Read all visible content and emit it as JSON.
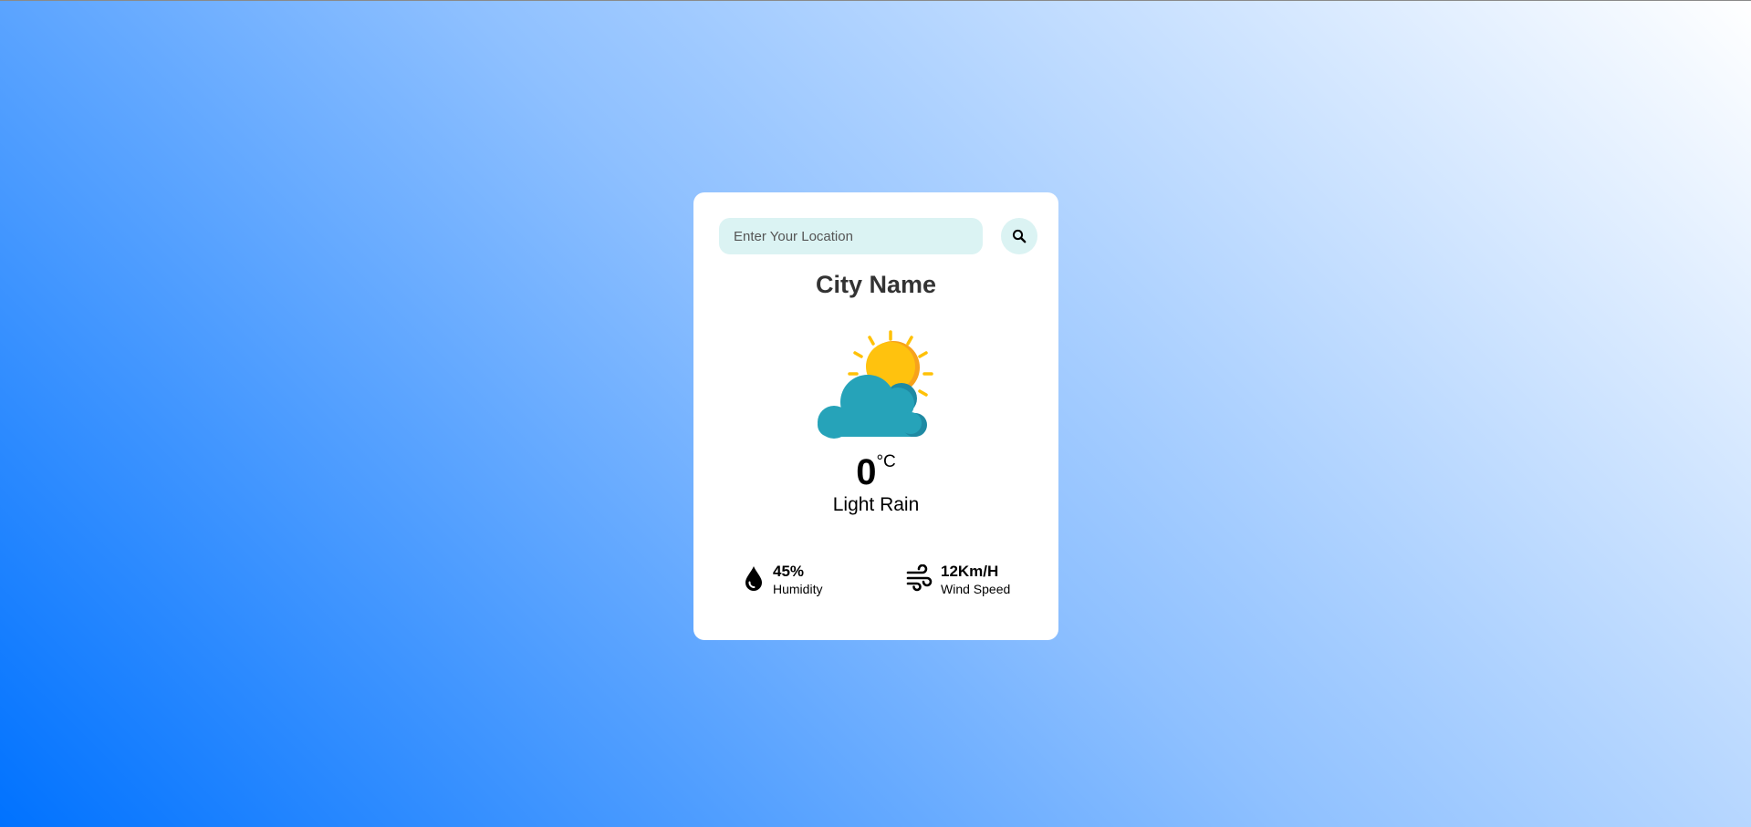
{
  "search": {
    "placeholder": "Enter Your Location",
    "value": ""
  },
  "weather": {
    "city": "City Name",
    "temperature": "0",
    "unit": "°C",
    "condition": "Light Rain",
    "icon": "sun-behind-cloud-icon"
  },
  "details": {
    "humidity": {
      "value": "45%",
      "label": "Humidity",
      "icon": "water-drop-icon"
    },
    "wind": {
      "value": "12Km/H",
      "label": "Wind Speed",
      "icon": "wind-icon"
    }
  },
  "colors": {
    "input_bg": "#dbf3f3",
    "card_bg": "#ffffff",
    "gradient_start": "#0072ff",
    "gradient_end": "#ffffff",
    "sun": "#ffc107",
    "cloud": "#26a3b9"
  }
}
